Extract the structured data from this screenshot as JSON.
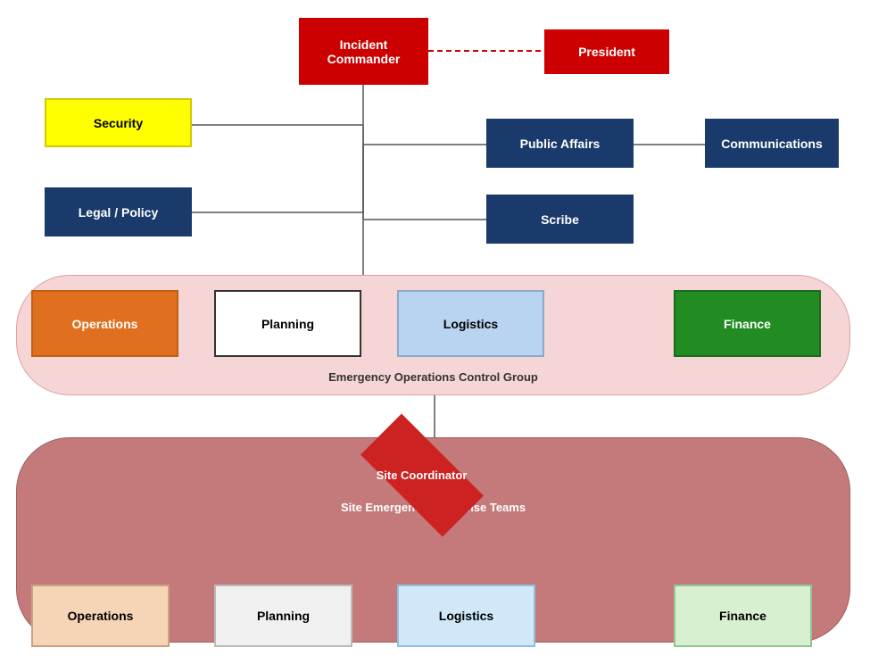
{
  "boxes": {
    "incident_commander": "Incident\nCommander",
    "president": "President",
    "security": "Security",
    "legal_policy": "Legal / Policy",
    "public_affairs": "Public Affairs",
    "communications": "Communications",
    "scribe": "Scribe",
    "eoc_label": "Emergency Operations Control Group",
    "operations_eoc": "Operations",
    "planning_eoc": "Planning",
    "logistics_eoc": "Logistics",
    "finance_eoc": "Finance",
    "site_coordinator": "Site Coordinator",
    "sert_label": "Site Emergency Response Teams",
    "operations_sert": "Operations",
    "planning_sert": "Planning",
    "logistics_sert": "Logistics",
    "finance_sert": "Finance"
  }
}
